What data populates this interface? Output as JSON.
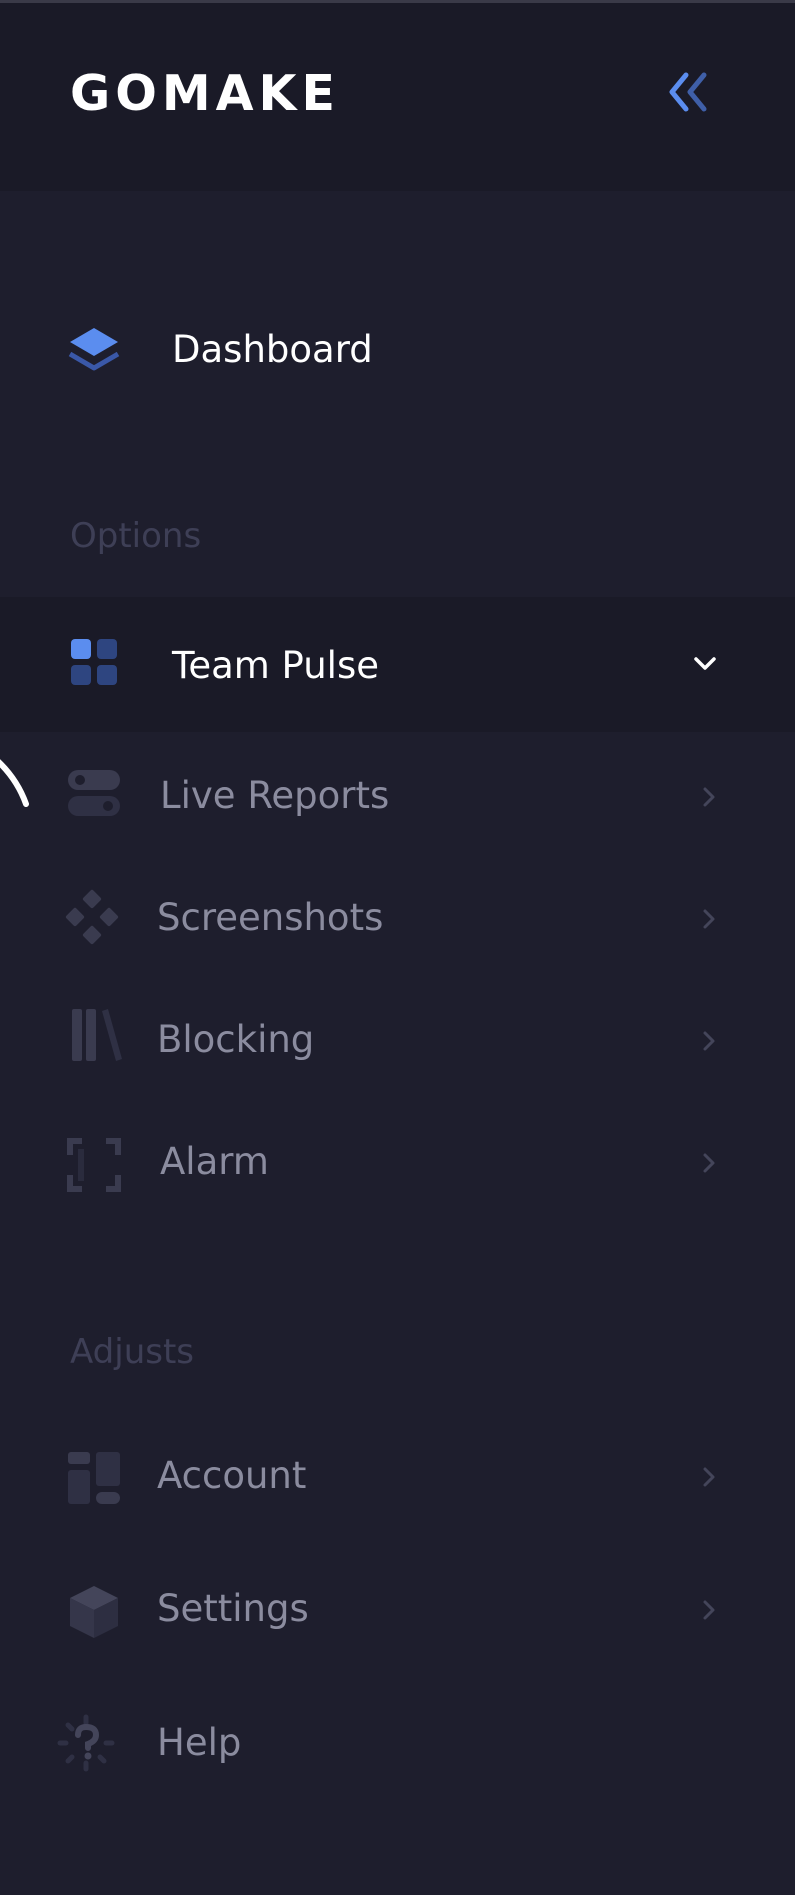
{
  "brand": {
    "logo_text": "GOMAKE"
  },
  "dashboard": {
    "label": "Dashboard"
  },
  "sections": {
    "options": {
      "title": "Options",
      "items": [
        {
          "label": "Team Pulse"
        },
        {
          "label": "Live Reports"
        },
        {
          "label": "Screenshots"
        },
        {
          "label": "Blocking"
        },
        {
          "label": "Alarm"
        }
      ]
    },
    "adjusts": {
      "title": "Adjusts",
      "items": [
        {
          "label": "Account"
        },
        {
          "label": "Settings"
        },
        {
          "label": "Help"
        }
      ]
    }
  },
  "colors": {
    "background": "#1e1e2d",
    "header": "#1a1a27",
    "accent": "#5b8def",
    "active_text": "#ffffff",
    "muted_text": "#8b8c9f",
    "section_title": "#3e3f56"
  },
  "icons": {
    "collapse": "double-chevron-left-icon",
    "dashboard": "layers-icon",
    "team_pulse": "grid-icon",
    "live_reports": "toggles-icon",
    "screenshots": "diamonds-icon",
    "blocking": "library-icon",
    "alarm": "frame-corners-icon",
    "account": "layout-icon",
    "settings": "box-icon",
    "help": "question-icon"
  }
}
